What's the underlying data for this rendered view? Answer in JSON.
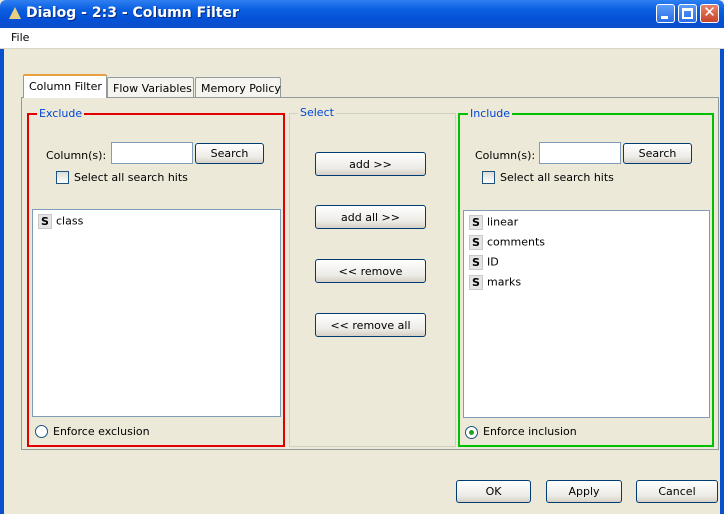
{
  "window": {
    "title": "Dialog - 2:3 - Column Filter"
  },
  "menu": {
    "file": "File"
  },
  "tabs": [
    {
      "label": "Column Filter"
    },
    {
      "label": "Flow Variables"
    },
    {
      "label": "Memory Policy"
    }
  ],
  "exclude": {
    "title": "Exclude",
    "border_color": "#e00000",
    "columns_label": "Column(s):",
    "search_value": "",
    "search_button": "Search",
    "select_all_label": "Select all search hits",
    "items": [
      {
        "type_icon": "S",
        "name": "class"
      }
    ],
    "enforce_label": "Enforce exclusion",
    "enforce_selected": false
  },
  "select": {
    "title": "Select",
    "add": "add >>",
    "add_all": "add all >>",
    "remove": "<< remove",
    "remove_all": "<< remove all"
  },
  "include": {
    "title": "Include",
    "border_color": "#00c000",
    "columns_label": "Column(s):",
    "search_value": "",
    "search_button": "Search",
    "select_all_label": "Select all search hits",
    "items": [
      {
        "type_icon": "S",
        "name": "linear"
      },
      {
        "type_icon": "S",
        "name": "comments"
      },
      {
        "type_icon": "S",
        "name": "ID"
      },
      {
        "type_icon": "S",
        "name": "marks"
      }
    ],
    "enforce_label": "Enforce inclusion",
    "enforce_selected": true
  },
  "footer": {
    "ok": "OK",
    "apply": "Apply",
    "cancel": "Cancel"
  }
}
